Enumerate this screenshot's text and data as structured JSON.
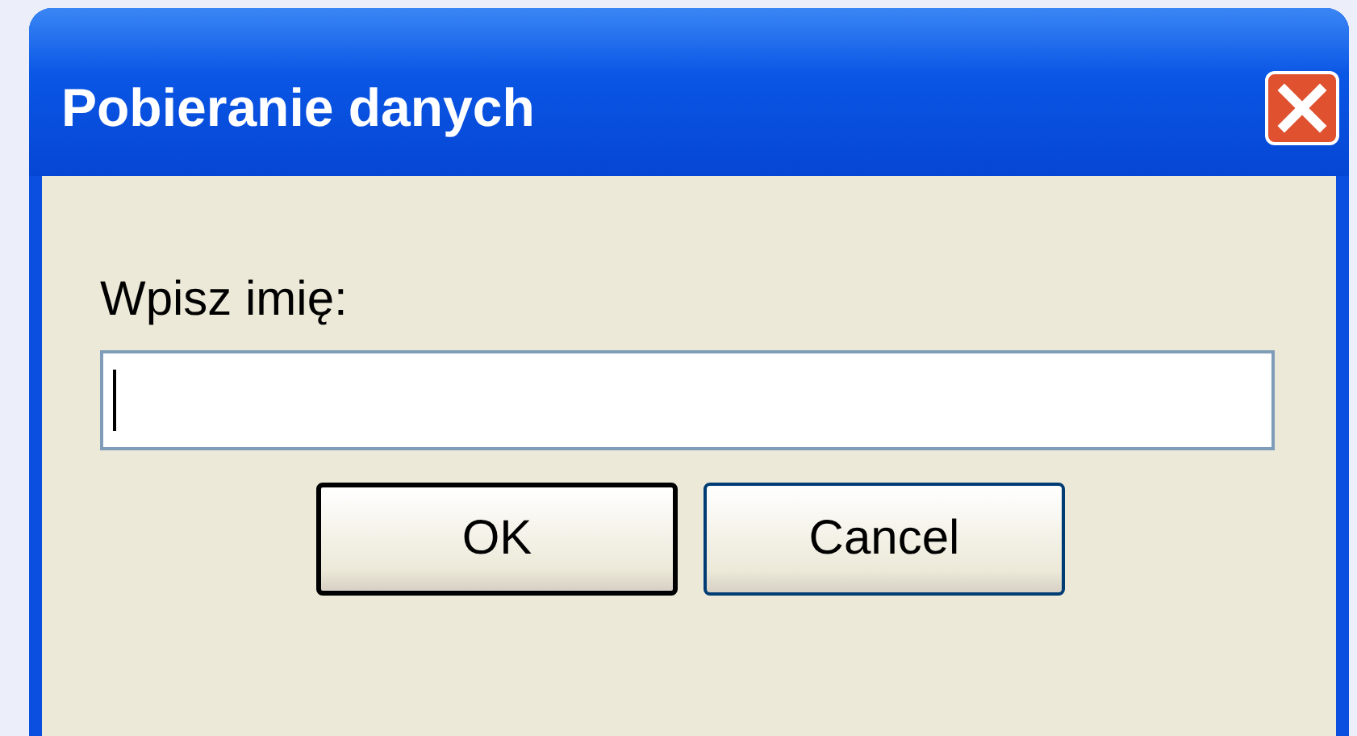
{
  "window": {
    "title": "Pobieranie danych"
  },
  "prompt": {
    "label": "Wpisz imię:"
  },
  "buttons": [
    {
      "label": "OK",
      "default": true
    },
    {
      "label": "Cancel",
      "default": false
    }
  ]
}
